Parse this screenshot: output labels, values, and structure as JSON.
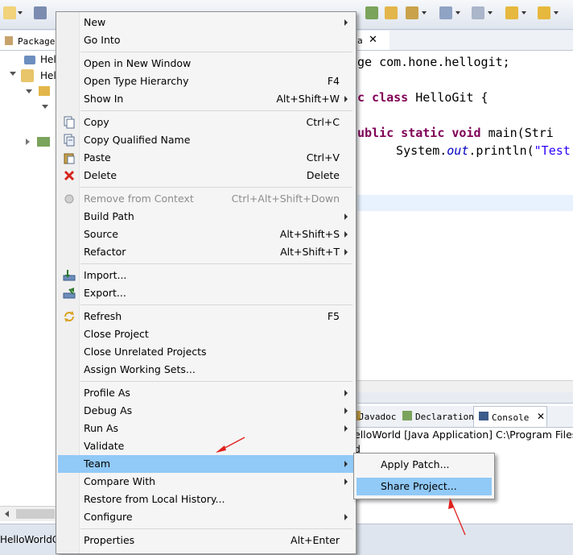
{
  "explorer": {
    "tab_label": "Package",
    "items": [
      {
        "label": "Hel"
      },
      {
        "label": "Hel"
      }
    ],
    "bottom_label": "HelloWorldG"
  },
  "editor": {
    "tab_label": "a",
    "lines": [
      {
        "parts": [
          {
            "t": "ge com.hone.hellogit;",
            "c": "plain"
          }
        ]
      },
      {
        "parts": [
          {
            "t": "c class ",
            "c": "kw"
          },
          {
            "t": "HelloGit {",
            "c": "plain"
          }
        ]
      },
      {
        "parts": [
          {
            "t": "ublic static void ",
            "c": "kw"
          },
          {
            "t": "main(Stri",
            "c": "plain"
          }
        ]
      },
      {
        "parts": [
          {
            "t": "  System.",
            "c": "plain"
          },
          {
            "t": "out",
            "c": "ital"
          },
          {
            "t": ".println(",
            "c": "plain"
          },
          {
            "t": "\"Test",
            "c": "str"
          }
        ]
      }
    ]
  },
  "console": {
    "tabs": [
      {
        "label": "Javadoc"
      },
      {
        "label": "Declaration"
      },
      {
        "label": "Console"
      }
    ],
    "line1": "elloWorld [Java Application] C:\\Program Files\\",
    "line2": "d"
  },
  "menu": {
    "items": [
      {
        "label": "New",
        "shortcut": "",
        "submenu": true,
        "disabled": false,
        "icon": ""
      },
      {
        "label": "Go Into",
        "shortcut": "",
        "submenu": false,
        "disabled": false,
        "icon": ""
      },
      {
        "sep": true
      },
      {
        "label": "Open in New Window",
        "shortcut": "",
        "submenu": false,
        "disabled": false,
        "icon": ""
      },
      {
        "label": "Open Type Hierarchy",
        "shortcut": "F4",
        "submenu": false,
        "disabled": false,
        "icon": ""
      },
      {
        "label": "Show In",
        "shortcut": "Alt+Shift+W",
        "submenu": true,
        "disabled": false,
        "icon": ""
      },
      {
        "sep": true
      },
      {
        "label": "Copy",
        "shortcut": "Ctrl+C",
        "submenu": false,
        "disabled": false,
        "icon": "copy-icon"
      },
      {
        "label": "Copy Qualified Name",
        "shortcut": "",
        "submenu": false,
        "disabled": false,
        "icon": "copy-qualified-icon"
      },
      {
        "label": "Paste",
        "shortcut": "Ctrl+V",
        "submenu": false,
        "disabled": false,
        "icon": "paste-icon"
      },
      {
        "label": "Delete",
        "shortcut": "Delete",
        "submenu": false,
        "disabled": false,
        "icon": "delete-icon"
      },
      {
        "sep": true
      },
      {
        "label": "Remove from Context",
        "shortcut": "Ctrl+Alt+Shift+Down",
        "submenu": false,
        "disabled": true,
        "icon": "remove-context-icon"
      },
      {
        "label": "Build Path",
        "shortcut": "",
        "submenu": true,
        "disabled": false,
        "icon": ""
      },
      {
        "label": "Source",
        "shortcut": "Alt+Shift+S",
        "submenu": true,
        "disabled": false,
        "icon": ""
      },
      {
        "label": "Refactor",
        "shortcut": "Alt+Shift+T",
        "submenu": true,
        "disabled": false,
        "icon": ""
      },
      {
        "sep": true
      },
      {
        "label": "Import...",
        "shortcut": "",
        "submenu": false,
        "disabled": false,
        "icon": "import-icon"
      },
      {
        "label": "Export...",
        "shortcut": "",
        "submenu": false,
        "disabled": false,
        "icon": "export-icon"
      },
      {
        "sep": true
      },
      {
        "label": "Refresh",
        "shortcut": "F5",
        "submenu": false,
        "disabled": false,
        "icon": "refresh-icon"
      },
      {
        "label": "Close Project",
        "shortcut": "",
        "submenu": false,
        "disabled": false,
        "icon": ""
      },
      {
        "label": "Close Unrelated Projects",
        "shortcut": "",
        "submenu": false,
        "disabled": false,
        "icon": ""
      },
      {
        "label": "Assign Working Sets...",
        "shortcut": "",
        "submenu": false,
        "disabled": false,
        "icon": ""
      },
      {
        "sep": true
      },
      {
        "label": "Profile As",
        "shortcut": "",
        "submenu": true,
        "disabled": false,
        "icon": ""
      },
      {
        "label": "Debug As",
        "shortcut": "",
        "submenu": true,
        "disabled": false,
        "icon": ""
      },
      {
        "label": "Run As",
        "shortcut": "",
        "submenu": true,
        "disabled": false,
        "icon": ""
      },
      {
        "label": "Validate",
        "shortcut": "",
        "submenu": false,
        "disabled": false,
        "icon": ""
      },
      {
        "label": "Team",
        "shortcut": "",
        "submenu": true,
        "disabled": false,
        "icon": "",
        "highlighted": true
      },
      {
        "label": "Compare With",
        "shortcut": "",
        "submenu": true,
        "disabled": false,
        "icon": ""
      },
      {
        "label": "Restore from Local History...",
        "shortcut": "",
        "submenu": false,
        "disabled": false,
        "icon": ""
      },
      {
        "label": "Configure",
        "shortcut": "",
        "submenu": true,
        "disabled": false,
        "icon": ""
      },
      {
        "sep": true
      },
      {
        "label": "Properties",
        "shortcut": "Alt+Enter",
        "submenu": false,
        "disabled": false,
        "icon": ""
      }
    ]
  },
  "submenu": {
    "items": [
      {
        "label": "Apply Patch..."
      },
      {
        "label": "Share Project...",
        "highlighted": true
      }
    ]
  },
  "colors": {
    "highlight": "#91c9f7",
    "annotation_arrow": "#e0201e"
  }
}
